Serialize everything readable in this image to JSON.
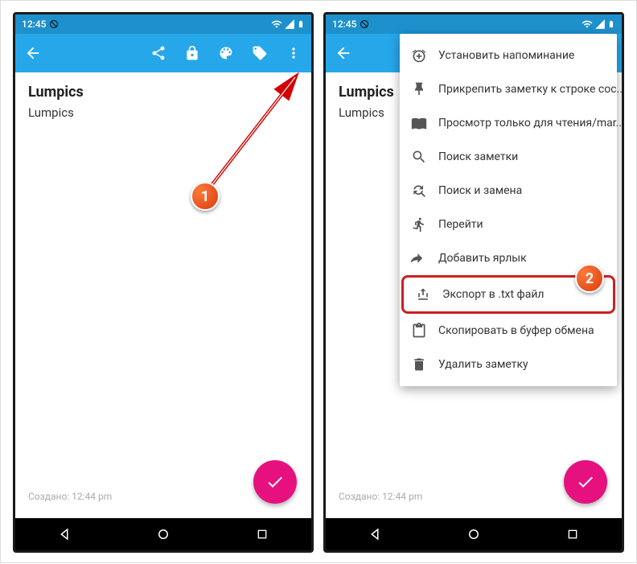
{
  "status": {
    "time": "12:45"
  },
  "note": {
    "title": "Lumpics",
    "body": "Lumpics",
    "created": "Создано: 12:44 pm"
  },
  "menu": {
    "items": [
      {
        "label": "Установить напоминание"
      },
      {
        "label": "Прикрепить заметку к строке сос.."
      },
      {
        "label": "Просмотр только для чтения/mar.."
      },
      {
        "label": "Поиск заметки"
      },
      {
        "label": "Поиск и замена"
      },
      {
        "label": "Перейти"
      },
      {
        "label": "Добавить ярлык"
      },
      {
        "label": "Экспорт в .txt файл"
      },
      {
        "label": "Скопировать в буфер обмена"
      },
      {
        "label": "Удалить заметку"
      }
    ]
  },
  "badges": {
    "one": "1",
    "two": "2"
  }
}
